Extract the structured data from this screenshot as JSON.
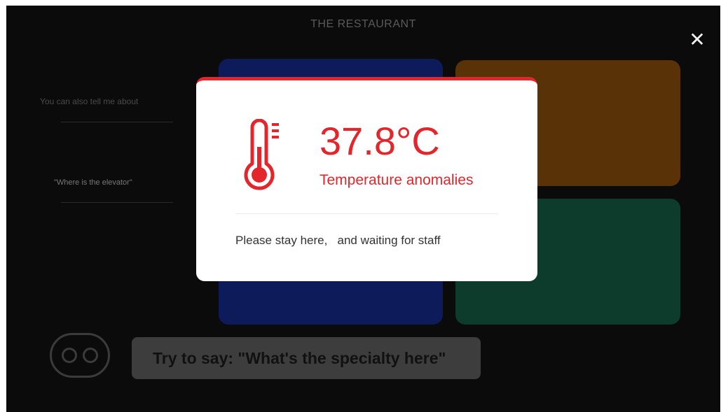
{
  "header": {
    "title": "THE RESTAURANT"
  },
  "close_icon": "✕",
  "left_panel": {
    "intro": "You can also tell me about",
    "example_question": "\"Where is the elevator\""
  },
  "prompt": {
    "text": "Try to say: \"What's the specialty here\""
  },
  "alert": {
    "temperature": "37.8°C",
    "status": "Temperature anomalies",
    "message": "Please stay here,   and waiting for staff",
    "accent_color": "#e4262c",
    "icon": "thermometer-icon"
  }
}
